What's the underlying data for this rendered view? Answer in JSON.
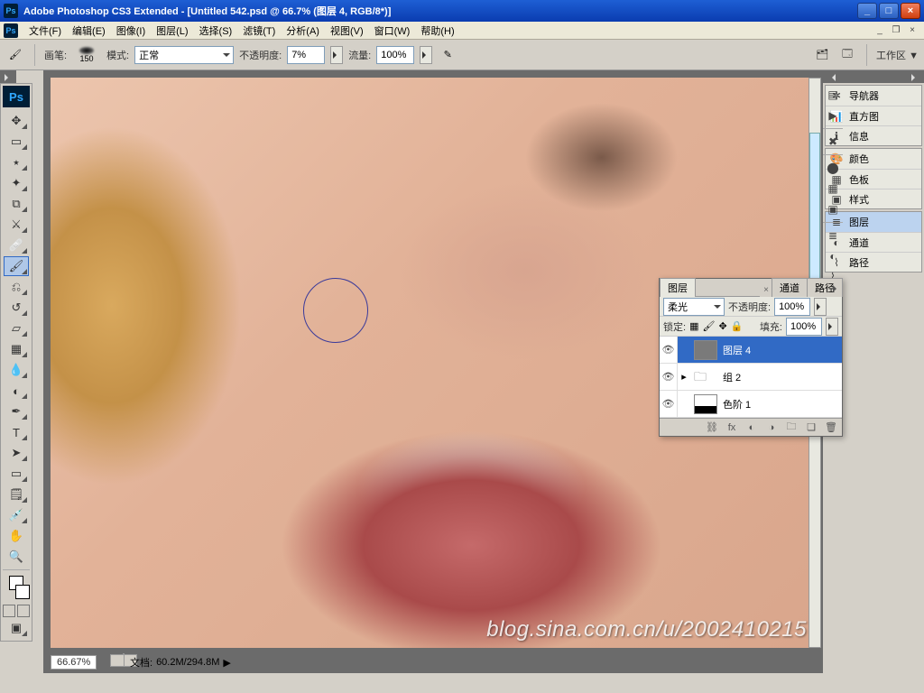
{
  "title": "Adobe Photoshop CS3 Extended - [Untitled 542.psd @ 66.7% (图层 4, RGB/8*)]",
  "menu": [
    "文件(F)",
    "编辑(E)",
    "图像(I)",
    "图层(L)",
    "选择(S)",
    "滤镜(T)",
    "分析(A)",
    "视图(V)",
    "窗口(W)",
    "帮助(H)"
  ],
  "options": {
    "brush_label": "画笔:",
    "brush_size": "150",
    "mode_label": "模式:",
    "mode_value": "正常",
    "opacity_label": "不透明度:",
    "opacity_value": "7%",
    "flow_label": "流量:",
    "flow_value": "100%",
    "workspace_label": "工作区 ▼"
  },
  "dock": {
    "nav": "导航器",
    "hist": "直方图",
    "info": "信息",
    "color": "颜色",
    "swatch": "色板",
    "styles": "样式",
    "layers": "图层",
    "channels": "通道",
    "paths": "路径"
  },
  "layers_panel": {
    "tab_layers": "图层",
    "tab_channels": "通道",
    "tab_paths": "路径",
    "blend_value": "柔光",
    "opacity_label": "不透明度:",
    "opacity_value": "100%",
    "lock_label": "锁定:",
    "fill_label": "填充:",
    "fill_value": "100%",
    "layer4": "图层 4",
    "group2": "组 2",
    "levels1": "色阶 1"
  },
  "status": {
    "zoom": "66.67%",
    "doc_label": "文档:",
    "doc_value": "60.2M/294.8M"
  },
  "watermark": "blog.sina.com.cn/u/2002410215"
}
